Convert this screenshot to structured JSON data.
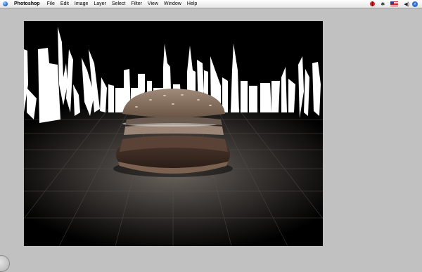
{
  "menubar": {
    "apple_icon": "apple-icon",
    "app_name": "Photoshop",
    "items": [
      "File",
      "Edit",
      "Image",
      "Layer",
      "Select",
      "Filter",
      "View",
      "Window",
      "Help"
    ],
    "extras": [
      "ladybug-icon",
      "bluetooth-icon",
      "us-flag-icon",
      "volume-icon",
      "spotlight-icon"
    ]
  },
  "document": {
    "content": "burger-skyline-image"
  },
  "colors": {
    "desktop": "#c1c1c1",
    "canvas_bg": "#000000",
    "skyline": "#ffffff"
  }
}
